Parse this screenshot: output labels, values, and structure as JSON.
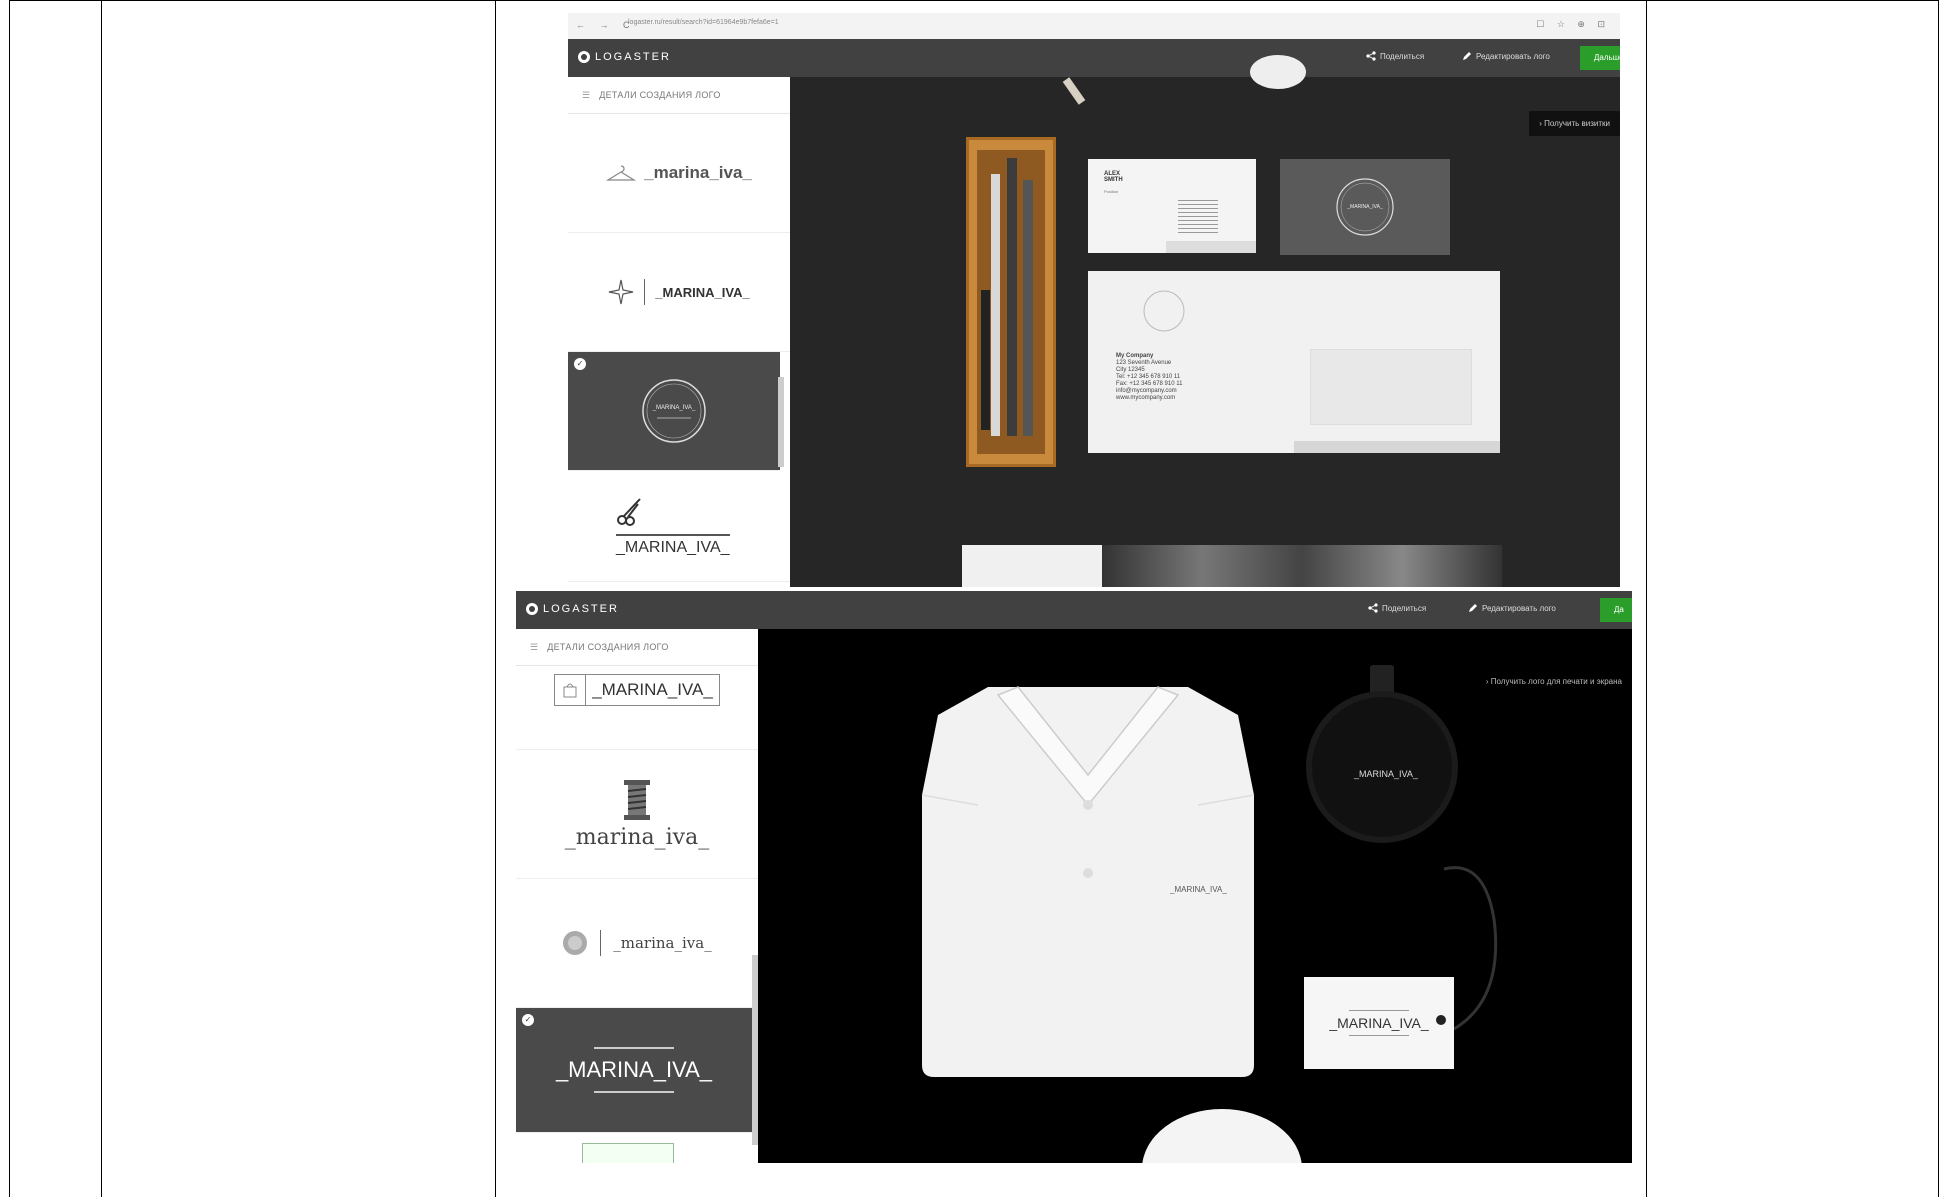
{
  "shot1": {
    "browser": {
      "nav_icons": "← → C",
      "url": "logaster.ru/result/search?id=61964e9b7fefa6e=1",
      "controls": "☐ ☆ ⊕ ⊡"
    },
    "brand": "LOGASTER",
    "share_label": "Поделиться",
    "edit_label": "Редактировать лого",
    "download_label": "Дальше",
    "sidebar_header": "ДЕТАЛИ СОЗДАНИЯ ЛОГО",
    "logos": [
      {
        "text": "_marina_iva_"
      },
      {
        "text": "_MARINA_IVA_"
      },
      {
        "text": "_MARINA_IVA_",
        "selected": true
      },
      {
        "text": "_MARINA_IVA_"
      }
    ],
    "mockup_cta": "› Получить визитки",
    "business_card": {
      "name": "ALEX SMITH",
      "role": "Position"
    },
    "envelope": {
      "company": "My Company",
      "address": "123 Seventh Avenue",
      "city": "City 12345",
      "tel": "Tel: +12 345 678 910 11",
      "fax": "Fax: +12 345 678 910 11",
      "email": "info@mycompany.com",
      "site": "www.mycompany.com"
    },
    "badge_text": "_MARINA_IVA_"
  },
  "shot2": {
    "brand": "LOGASTER",
    "share_label": "Поделиться",
    "edit_label": "Редактировать лого",
    "download_label": "Да",
    "sidebar_header": "ДЕТАЛИ СОЗДАНИЯ ЛОГО",
    "logos": [
      {
        "text": "_MARINA_IVA_"
      },
      {
        "text": "_marina_iva_"
      },
      {
        "text": "_marina_iva_"
      },
      {
        "text": "_MARINA_IVA_",
        "selected": true
      }
    ],
    "mockup_cta": "› Получить лого для печати и экрана",
    "shirt_logo": "_MARINA_IVA_",
    "flask_logo": "_MARINA_IVA_",
    "tag_logo": "_MARINA_IVA_"
  },
  "colors": {
    "appbar": "#414141",
    "accent_green": "#2a9d2a",
    "canvas_dark": "#262626",
    "canvas_black": "#000000"
  }
}
